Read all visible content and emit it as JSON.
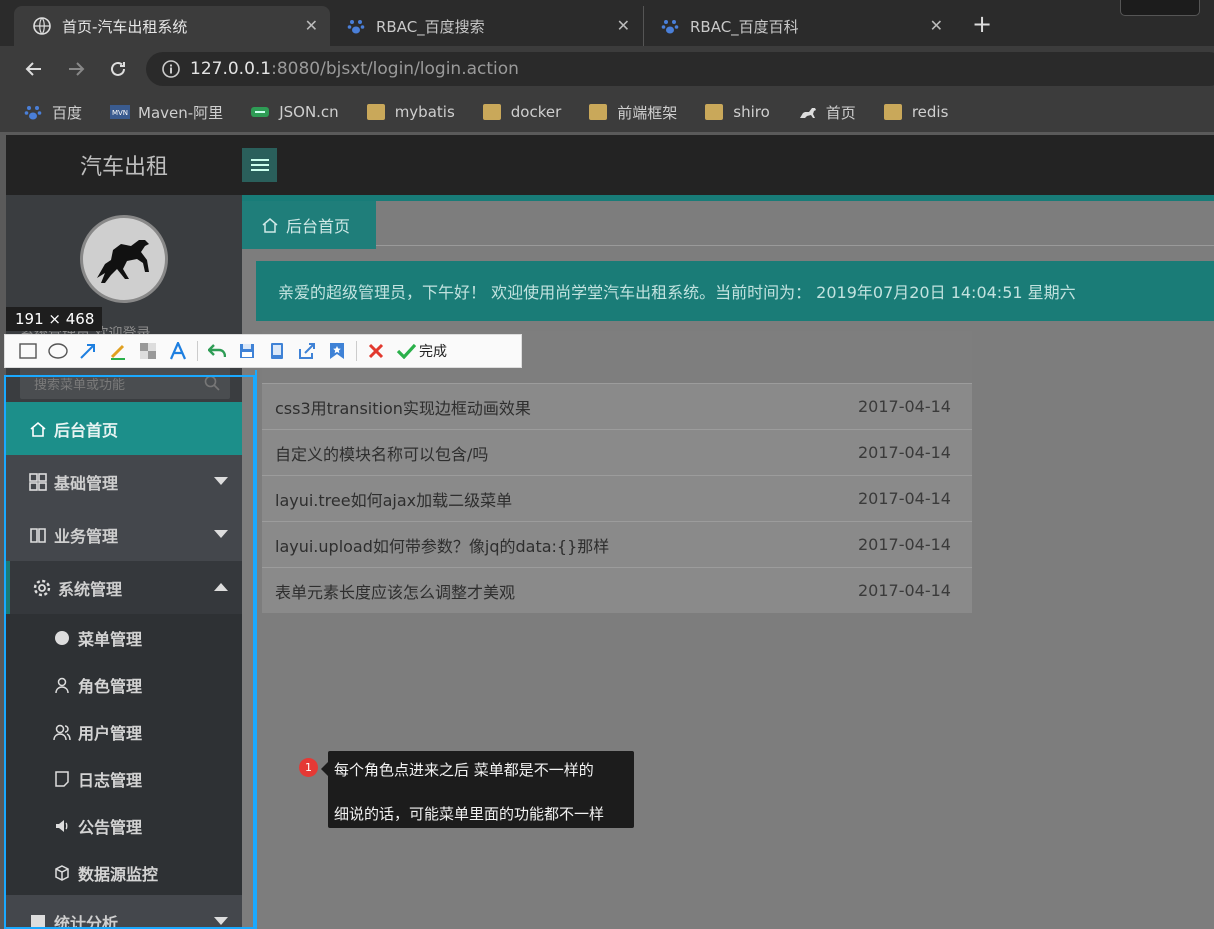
{
  "browser": {
    "tabs": [
      {
        "title": "首页-汽车出租系统"
      },
      {
        "title": "RBAC_百度搜索"
      },
      {
        "title": "RBAC_百度百科"
      }
    ],
    "url_host": "127.0.0.1",
    "url_rest": ":8080/bjsxt/login/login.action",
    "bookmarks": [
      {
        "label": "百度",
        "icon": "paw-icon"
      },
      {
        "label": "Maven-阿里",
        "icon": "maven-icon"
      },
      {
        "label": "JSON.cn",
        "icon": "json-icon"
      },
      {
        "label": "mybatis",
        "icon": "folder-icon"
      },
      {
        "label": "docker",
        "icon": "folder-icon"
      },
      {
        "label": "前端框架",
        "icon": "folder-icon"
      },
      {
        "label": "shiro",
        "icon": "folder-icon"
      },
      {
        "label": "首页",
        "icon": "horse-icon"
      },
      {
        "label": "redis",
        "icon": "folder-icon"
      }
    ]
  },
  "app": {
    "brand": "汽车出租",
    "welcome": "系统管理员 欢迎登录",
    "search_placeholder": "搜索菜单或功能",
    "menu": {
      "home": "后台首页",
      "base": "基础管理",
      "business": "业务管理",
      "system": "系统管理",
      "stats": "统计分析",
      "system_sub": [
        {
          "label": "菜单管理",
          "icon": "circle-icon"
        },
        {
          "label": "角色管理",
          "icon": "user-icon"
        },
        {
          "label": "用户管理",
          "icon": "users-icon"
        },
        {
          "label": "日志管理",
          "icon": "note-icon"
        },
        {
          "label": "公告管理",
          "icon": "speaker-icon"
        },
        {
          "label": "数据源监控",
          "icon": "cube-icon"
        }
      ]
    },
    "content_tab": "后台首页",
    "banner": "亲爱的超级管理员，下午好！ 欢迎使用尚学堂汽车出租系统。当前时间为： 2019年07月20日 14:04:51   星期六",
    "news": [
      {
        "title": "css3用transition实现边框动画效果",
        "date": "2017-04-14"
      },
      {
        "title": "自定义的模块名称可以包含/吗",
        "date": "2017-04-14"
      },
      {
        "title": "layui.tree如何ajax加载二级菜单",
        "date": "2017-04-14"
      },
      {
        "title": "layui.upload如何带参数？像jq的data:{}那样",
        "date": "2017-04-14"
      },
      {
        "title": "表单元素长度应该怎么调整才美观",
        "date": "2017-04-14"
      }
    ]
  },
  "capture": {
    "size_label": "191 × 468",
    "done": "完成"
  },
  "note": {
    "badge": "1",
    "line1": "每个角色点进来之后 菜单都是不一样的",
    "line2": "细说的话，可能菜单里面的功能都不一样"
  }
}
